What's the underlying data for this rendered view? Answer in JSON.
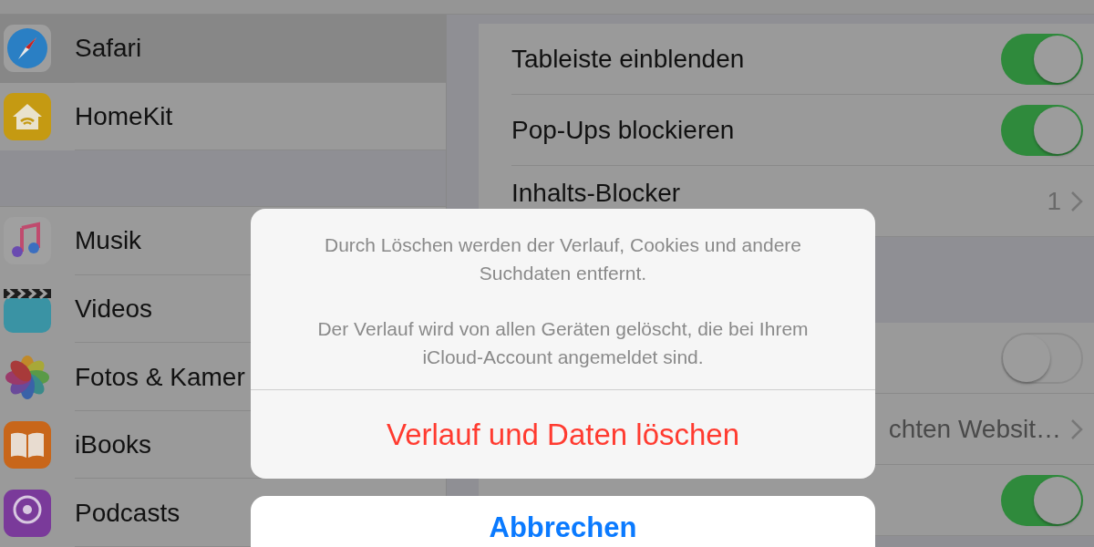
{
  "sidebar": {
    "groups": [
      {
        "items": [
          {
            "label": "Safari",
            "selected": true
          },
          {
            "label": "HomeKit",
            "selected": false
          }
        ]
      },
      {
        "items": [
          {
            "label": "Musik",
            "selected": false
          },
          {
            "label": "Videos",
            "selected": false
          },
          {
            "label": "Fotos & Kamer",
            "selected": false
          },
          {
            "label": "iBooks",
            "selected": false
          },
          {
            "label": "Podcasts",
            "selected": false
          }
        ]
      }
    ]
  },
  "settings": {
    "sections": [
      {
        "rows": [
          {
            "kind": "toggle",
            "label": "Tableiste einblenden",
            "on": true
          },
          {
            "kind": "toggle",
            "label": "Pop-Ups blockieren",
            "on": true
          },
          {
            "kind": "link",
            "label": "Inhalts-Blocker",
            "value": "1"
          }
        ]
      },
      {
        "rows": [
          {
            "kind": "toggle",
            "on": false
          },
          {
            "kind": "link",
            "value": "chten Websit…"
          },
          {
            "kind": "toggle",
            "on": true
          }
        ]
      }
    ]
  },
  "action_sheet": {
    "message": [
      "Durch Löschen werden der Verlauf, Cookies und andere Suchdaten entfernt.",
      "Der Verlauf wird von allen Geräten gelöscht, die bei Ihrem iCloud-Account angemeldet sind."
    ],
    "actions": [
      {
        "kind": "destructive",
        "label": "Verlauf und Daten löschen"
      }
    ],
    "cancel": {
      "label": "Abbrechen"
    }
  }
}
